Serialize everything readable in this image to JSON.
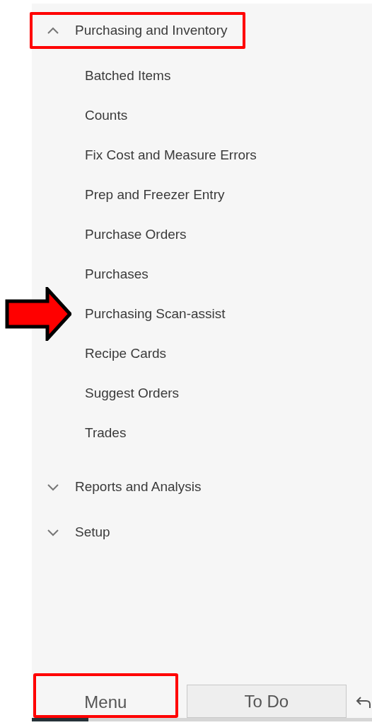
{
  "menu": [
    {
      "label": "Purchasing and Inventory",
      "expanded": true,
      "highlighted": true,
      "children": [
        {
          "label": "Batched Items",
          "pointed": false
        },
        {
          "label": "Counts",
          "pointed": false
        },
        {
          "label": "Fix Cost and Measure Errors",
          "pointed": false
        },
        {
          "label": "Prep and Freezer Entry",
          "pointed": false
        },
        {
          "label": "Purchase Orders",
          "pointed": false
        },
        {
          "label": "Purchases",
          "pointed": false
        },
        {
          "label": "Purchasing Scan-assist",
          "pointed": true
        },
        {
          "label": "Recipe Cards",
          "pointed": false
        },
        {
          "label": "Suggest Orders",
          "pointed": false
        },
        {
          "label": "Trades",
          "pointed": false
        }
      ]
    },
    {
      "label": "Reports and Analysis",
      "expanded": false,
      "highlighted": false
    },
    {
      "label": "Setup",
      "expanded": false,
      "highlighted": false
    }
  ],
  "tabs": [
    {
      "label": "Menu",
      "selected": true,
      "highlighted": true
    },
    {
      "label": "To Do",
      "selected": false,
      "highlighted": false
    }
  ]
}
